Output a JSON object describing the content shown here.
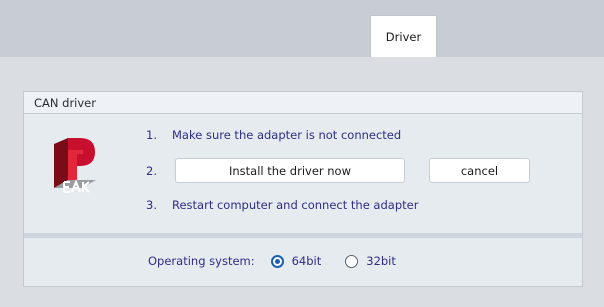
{
  "tabs": [
    {
      "label": "Driver",
      "active": true
    }
  ],
  "panel": {
    "title": "CAN driver",
    "logo_icon": "peak-logo-icon",
    "steps": [
      {
        "number": "1.",
        "text": "Make sure the adapter is not connected"
      },
      {
        "number": "2.",
        "text": ""
      },
      {
        "number": "3.",
        "text": "Restart computer and connect the adapter"
      }
    ],
    "install_button_label": "Install the driver now",
    "cancel_button_label": "cancel",
    "os": {
      "label": "Operating system:",
      "options": [
        {
          "label": "64bit",
          "selected": true
        },
        {
          "label": "32bit",
          "selected": false
        }
      ]
    }
  },
  "colors": {
    "accent": "#1a5fb4",
    "step_text": "#2f2d86",
    "panel_bg": "#e6ebf0",
    "tabbar_bg": "#c8cdd3",
    "window_bg": "#dadde1",
    "logo_red": "#c8102e"
  }
}
